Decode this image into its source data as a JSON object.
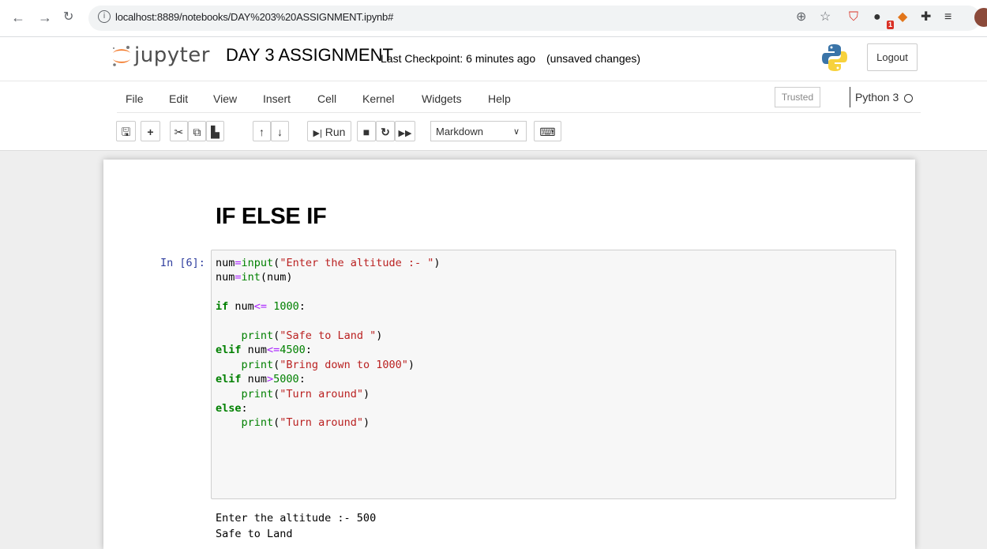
{
  "browser": {
    "url": "localhost:8889/notebooks/DAY%203%20ASSIGNMENT.ipynb#",
    "extension_badge": "1"
  },
  "header": {
    "logo_text": "jupyter",
    "notebook_name": "DAY 3 ASSIGNMENT",
    "checkpoint": "Last Checkpoint: 6 minutes ago",
    "save_status": "(unsaved changes)",
    "logout_label": "Logout"
  },
  "menubar": {
    "items": [
      "File",
      "Edit",
      "View",
      "Insert",
      "Cell",
      "Kernel",
      "Widgets",
      "Help"
    ],
    "trusted_label": "Trusted",
    "kernel_name": "Python 3"
  },
  "toolbar": {
    "run_label": "Run",
    "cell_type": "Markdown"
  },
  "notebook": {
    "markdown_heading": "IF ELSE IF",
    "cell": {
      "prompt": "In [6]:",
      "code_lines": [
        "num=input(\"Enter the altitude :- \")",
        "num=int(num)",
        "",
        "if num<= 1000:",
        "",
        "    print(\"Safe to Land \")",
        "elif num<=4500:",
        "    print(\"Bring down to 1000\")",
        "elif num>5000:",
        "    print(\"Turn around\")",
        "else:",
        "    print(\"Turn around\")"
      ],
      "output_lines": [
        "Enter the altitude :- 500",
        "Safe to Land"
      ]
    }
  }
}
